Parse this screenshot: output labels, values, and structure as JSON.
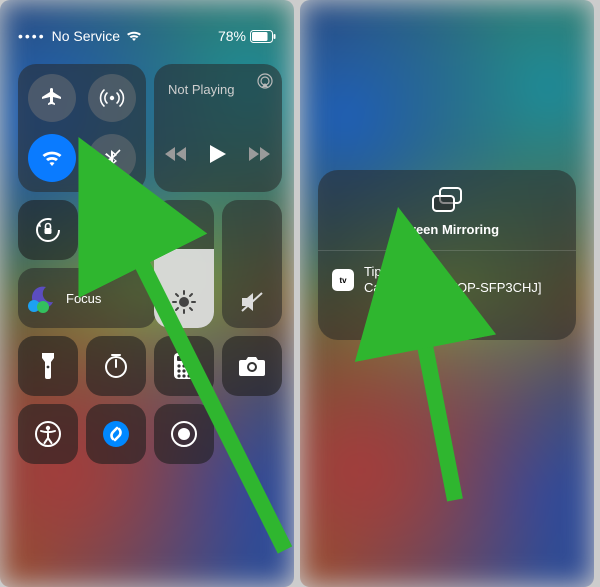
{
  "status": {
    "carrier": "No Service",
    "battery_pct": "78%"
  },
  "connectivity": {
    "airplane": "off",
    "cellular": "on",
    "wifi": "on",
    "bluetooth": "off"
  },
  "media": {
    "state": "Not Playing"
  },
  "focus": {
    "label": "Focus"
  },
  "mirroring": {
    "title": "Screen Mirroring",
    "device": "Tipard Screen Capture[DESKTOP-SFP3CHJ]"
  },
  "row2_tiles": [
    "orientation-lock",
    "screen-mirroring"
  ],
  "row4_tiles": [
    "flashlight",
    "timer",
    "calculator",
    "camera"
  ],
  "row5_tiles": [
    "accessibility",
    "shazam",
    "screen-record"
  ],
  "colors": {
    "accent_blue": "#0a7bff",
    "arrow_green": "#2fb62f"
  }
}
